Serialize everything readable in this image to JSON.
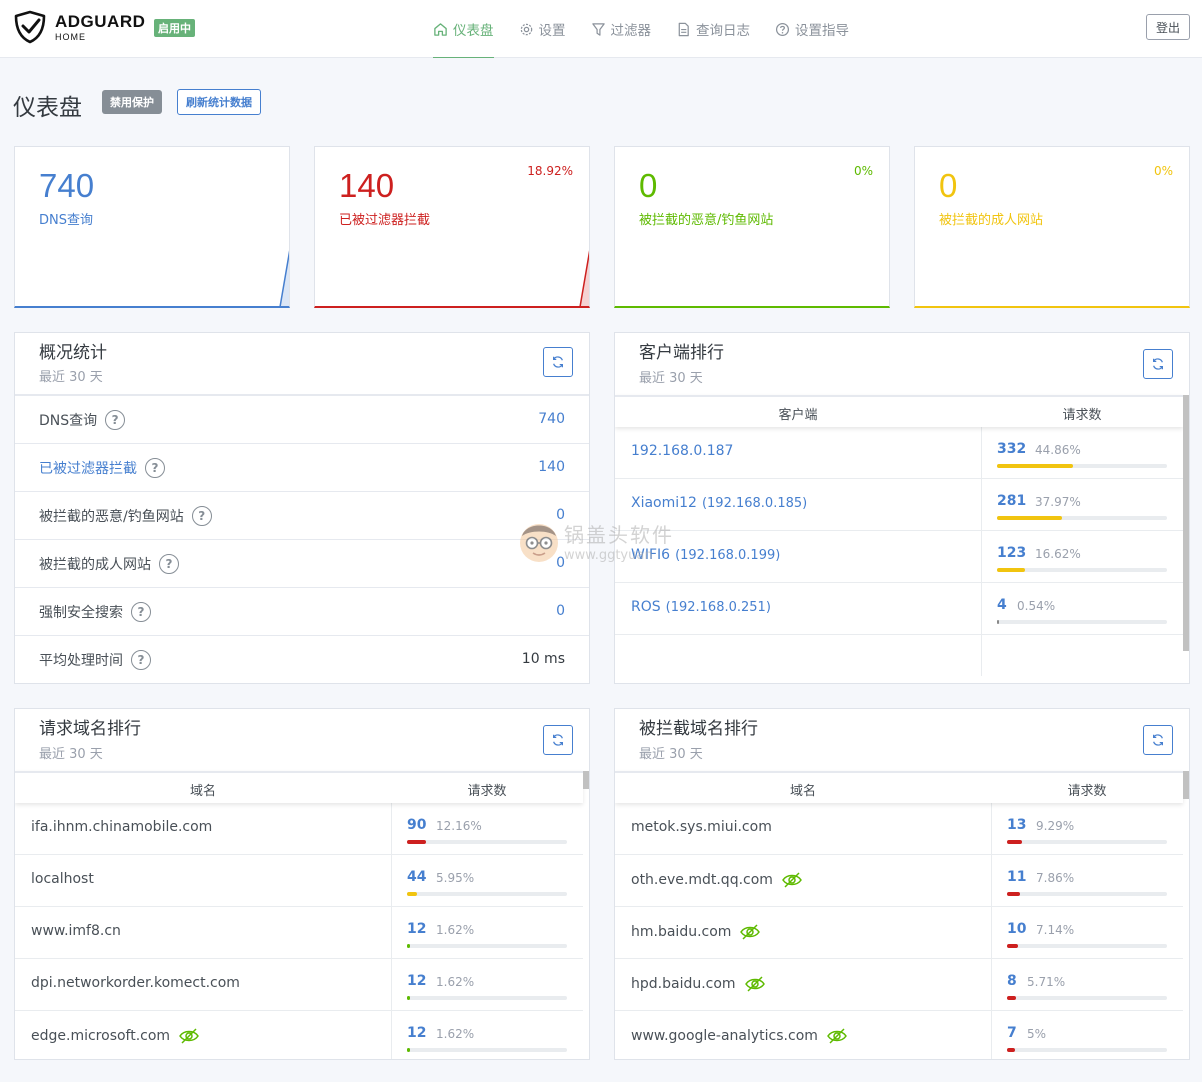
{
  "header": {
    "brand": "ADGUARD",
    "brand_sub": "HOME",
    "status": "启用中",
    "nav": [
      {
        "label": "仪表盘",
        "icon": "home-icon",
        "active": true
      },
      {
        "label": "设置",
        "icon": "gear-icon",
        "active": false
      },
      {
        "label": "过滤器",
        "icon": "filter-icon",
        "active": false
      },
      {
        "label": "查询日志",
        "icon": "document-icon",
        "active": false
      },
      {
        "label": "设置指导",
        "icon": "help-circle-icon",
        "active": false
      }
    ],
    "logout": "登出"
  },
  "page": {
    "title": "仪表盘",
    "disable_btn": "禁用保护",
    "refresh_btn": "刷新统计数据"
  },
  "cards": [
    {
      "value": "740",
      "label": "DNS查询",
      "percent": "",
      "color": "#467fcf"
    },
    {
      "value": "140",
      "label": "已被过滤器拦截",
      "percent": "18.92%",
      "color": "#cd201f"
    },
    {
      "value": "0",
      "label": "被拦截的恶意/钓鱼网站",
      "percent": "0%",
      "color": "#5eba00"
    },
    {
      "value": "0",
      "label": "被拦截的成人网站",
      "percent": "0%",
      "color": "#f1c40f"
    }
  ],
  "overview": {
    "title": "概况统计",
    "subtitle": "最近 30 天",
    "rows": [
      {
        "label": "DNS查询",
        "value": "740"
      },
      {
        "label": "已被过滤器拦截",
        "value": "140"
      },
      {
        "label": "被拦截的恶意/钓鱼网站",
        "value": "0"
      },
      {
        "label": "被拦截的成人网站",
        "value": "0"
      },
      {
        "label": "强制安全搜索",
        "value": "0"
      },
      {
        "label": "平均处理时间",
        "value": "10 ms"
      }
    ]
  },
  "clients": {
    "title": "客户端排行",
    "subtitle": "最近 30 天",
    "col_client": "客户端",
    "col_requests": "请求数",
    "rows": [
      {
        "name": "192.168.0.187",
        "ip": "",
        "count": "332",
        "percent": "44.86%",
        "fraction": 0.4486
      },
      {
        "name": "Xiaomi12",
        "ip": "(192.168.0.185)",
        "count": "281",
        "percent": "37.97%",
        "fraction": 0.3797
      },
      {
        "name": "WIFI6",
        "ip": "(192.168.0.199)",
        "count": "123",
        "percent": "16.62%",
        "fraction": 0.1662
      },
      {
        "name": "ROS",
        "ip": "(192.168.0.251)",
        "count": "4",
        "percent": "0.54%",
        "fraction": 0.0054
      }
    ]
  },
  "top_domains": {
    "title": "请求域名排行",
    "subtitle": "最近 30 天",
    "col_domain": "域名",
    "col_requests": "请求数",
    "rows": [
      {
        "name": "ifa.ihnm.chinamobile.com",
        "count": "90",
        "percent": "12.16%",
        "fraction": 0.1216,
        "hidden": false
      },
      {
        "name": "localhost",
        "count": "44",
        "percent": "5.95%",
        "fraction": 0.0595,
        "hidden": false
      },
      {
        "name": "www.imf8.cn",
        "count": "12",
        "percent": "1.62%",
        "fraction": 0.0162,
        "hidden": false
      },
      {
        "name": "dpi.networkorder.komect.com",
        "count": "12",
        "percent": "1.62%",
        "fraction": 0.0162,
        "hidden": false
      },
      {
        "name": "edge.microsoft.com",
        "count": "12",
        "percent": "1.62%",
        "fraction": 0.0162,
        "hidden": true
      }
    ]
  },
  "blocked_domains": {
    "title": "被拦截域名排行",
    "subtitle": "最近 30 天",
    "col_domain": "域名",
    "col_requests": "请求数",
    "rows": [
      {
        "name": "metok.sys.miui.com",
        "count": "13",
        "percent": "9.29%",
        "fraction": 0.0929,
        "hidden": false
      },
      {
        "name": "oth.eve.mdt.qq.com",
        "count": "11",
        "percent": "7.86%",
        "fraction": 0.0786,
        "hidden": true
      },
      {
        "name": "hm.baidu.com",
        "count": "10",
        "percent": "7.14%",
        "fraction": 0.0714,
        "hidden": true
      },
      {
        "name": "hpd.baidu.com",
        "count": "8",
        "percent": "5.71%",
        "fraction": 0.0571,
        "hidden": true
      },
      {
        "name": "www.google-analytics.com",
        "count": "7",
        "percent": "5%",
        "fraction": 0.05,
        "hidden": true
      }
    ]
  },
  "watermark": {
    "text": "锅盖头软件",
    "url": "www.ggtyuan"
  }
}
